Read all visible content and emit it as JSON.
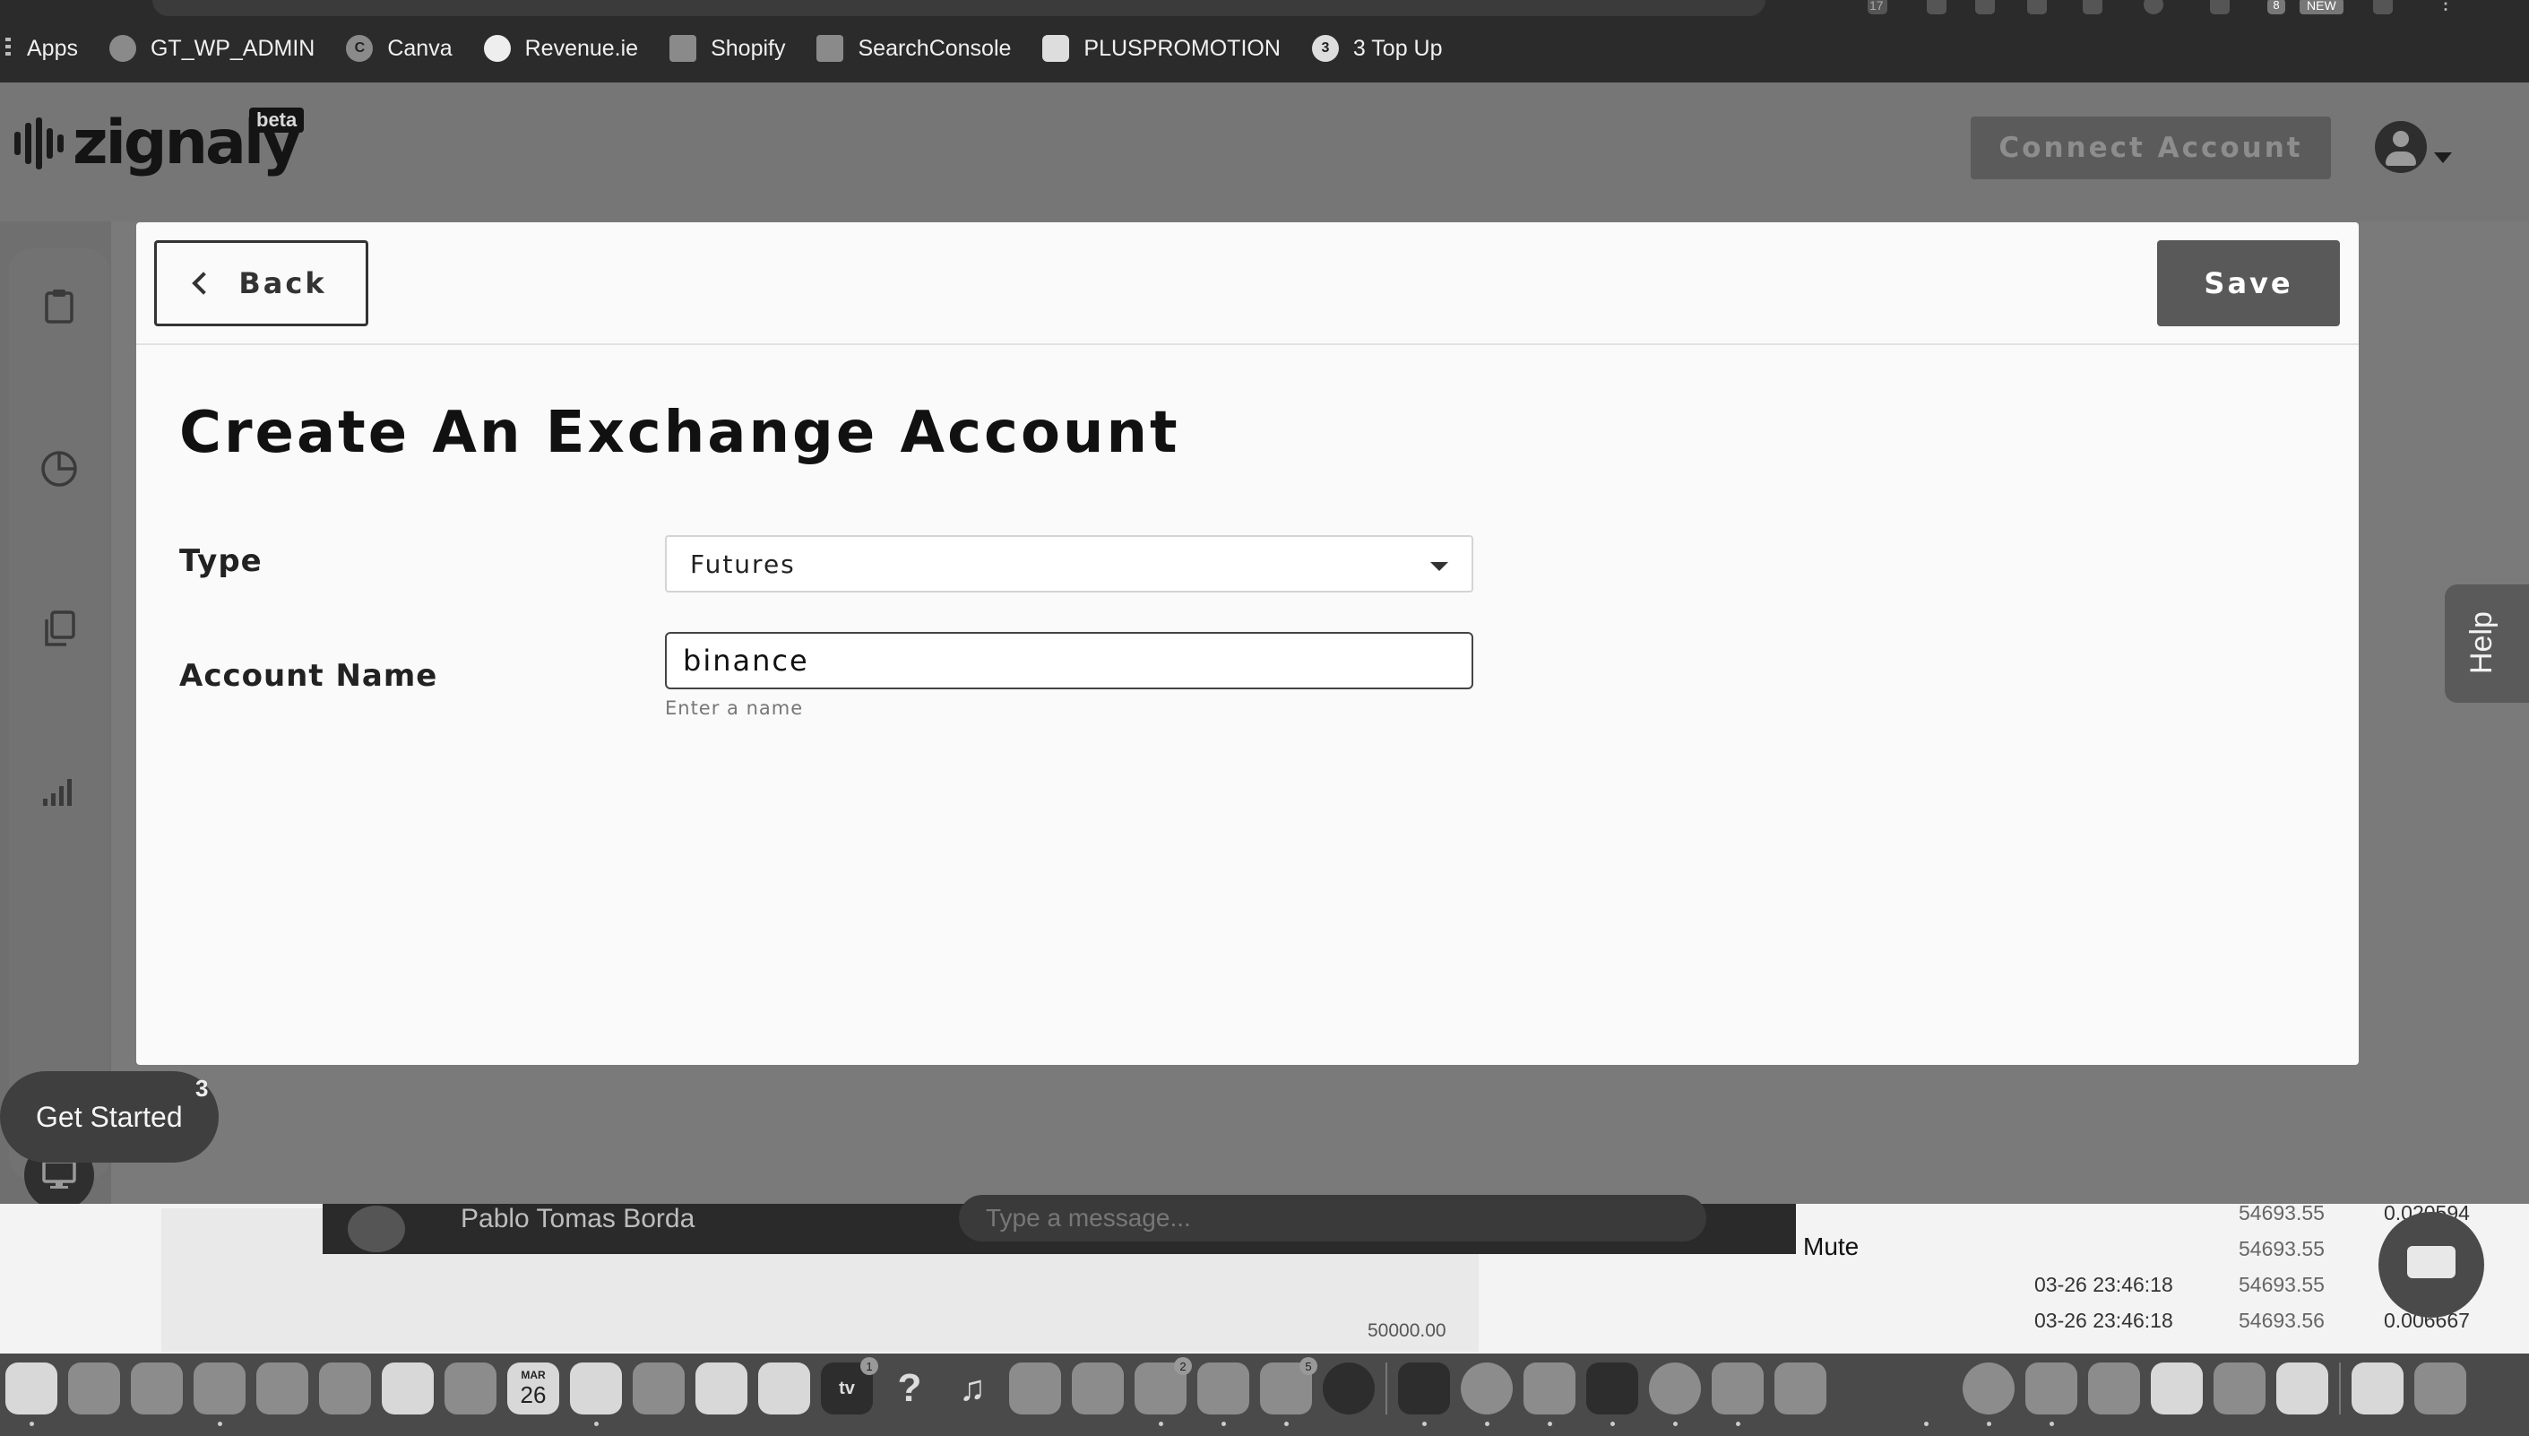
{
  "bookmarks": {
    "apps_label": "Apps",
    "items": [
      {
        "label": "GT_WP_ADMIN",
        "icon": "shield-icon",
        "glyph": ""
      },
      {
        "label": "Canva",
        "icon": "canva-icon",
        "glyph": "C"
      },
      {
        "label": "Revenue.ie",
        "icon": "harp-icon",
        "glyph": ""
      },
      {
        "label": "Shopify",
        "icon": "shopify-bag-icon",
        "glyph": ""
      },
      {
        "label": "SearchConsole",
        "icon": "search-console-icon",
        "glyph": ""
      },
      {
        "label": "PLUSPROMOTION",
        "icon": "globe-icon",
        "glyph": ""
      },
      {
        "label": "3 Top Up",
        "icon": "three-icon",
        "glyph": "3"
      }
    ]
  },
  "browser_toolbar": {
    "badge_count": "17",
    "extension_badge": "8",
    "new_badge": "NEW"
  },
  "app": {
    "brand": "zignaly",
    "beta_label": "beta",
    "connect_button": "Connect Account"
  },
  "sidebar": {
    "items": [
      {
        "name": "dashboard",
        "icon": "clipboard-icon"
      },
      {
        "name": "analytics",
        "icon": "pie-chart-icon"
      },
      {
        "name": "copy-trading",
        "icon": "copy-icon"
      },
      {
        "name": "signals",
        "icon": "signal-bars-icon"
      },
      {
        "name": "terminal",
        "icon": "monitor-icon",
        "active": true
      }
    ]
  },
  "get_started": {
    "label": "Get Started",
    "count": "3"
  },
  "help": {
    "label": "Help"
  },
  "modal": {
    "back_label": "Back",
    "save_label": "Save",
    "title": "Create An Exchange Account",
    "type_label": "Type",
    "type_value": "Futures",
    "account_name_label": "Account Name",
    "account_name_value": "binance",
    "account_name_hint": "Enter a name"
  },
  "background": {
    "chat_contact": "Pablo Tomas Borda",
    "chat_placeholder": "Type a message...",
    "mute_label": "Mute",
    "chart_label": "50000.00",
    "price_rows": [
      {
        "time": "",
        "price": "54693.55",
        "qty": "0.020594"
      },
      {
        "time": "",
        "price": "54693.55",
        "qty": ""
      },
      {
        "time": "03-26 23:46:18",
        "price": "54693.55",
        "qty": ""
      },
      {
        "time": "03-26 23:46:18",
        "price": "54693.56",
        "qty": "0.006667"
      }
    ]
  },
  "dock": {
    "calendar_month": "MAR",
    "calendar_day": "26",
    "tv_label": "tv",
    "badges": {
      "tv": "1",
      "prefs": "2",
      "outlook": "5"
    }
  }
}
